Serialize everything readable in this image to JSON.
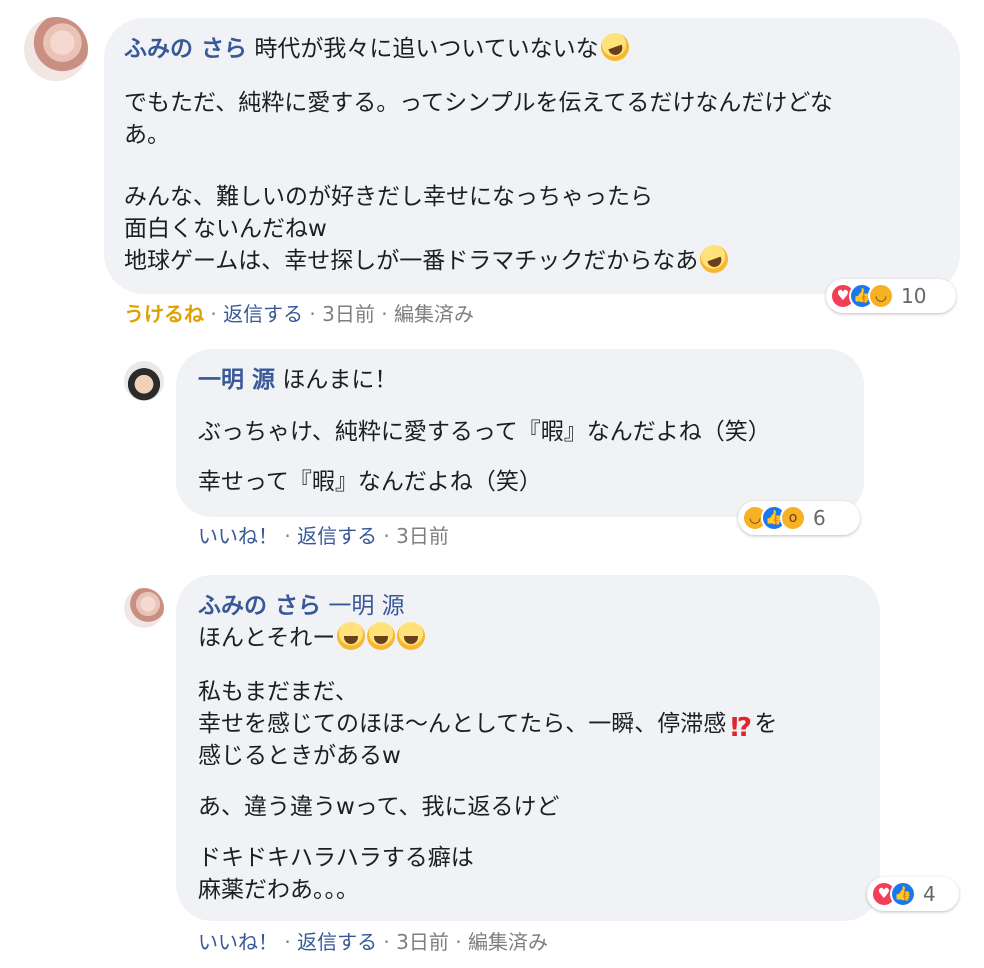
{
  "comments": [
    {
      "author": "ふみの さら",
      "line0": "時代が我々に追いついていないな",
      "body": [
        "でもただ、純粋に愛する。ってシンプルを伝えてるだけなんだけどな",
        "あ。",
        "みんな、難しいのが好きだし幸せになっちゃったら",
        "面白くないんだねw",
        "地球ゲームは、幸せ探しが一番ドラマチックだからなあ"
      ],
      "actions": {
        "like": "うけるね",
        "reply": "返信する",
        "time": "3日前",
        "edited": "編集済み"
      },
      "reactions": {
        "icons": [
          "love",
          "like",
          "haha"
        ],
        "count": "10"
      }
    },
    {
      "author": "一明 源",
      "line0": "ほんまに！",
      "body": [
        "ぶっちゃけ、純粋に愛するって『暇』なんだよね（笑）",
        "幸せって『暇』なんだよね（笑）"
      ],
      "actions": {
        "like": "いいね！",
        "reply": "返信する",
        "time": "3日前"
      },
      "reactions": {
        "icons": [
          "haha",
          "like",
          "wow"
        ],
        "count": "6"
      }
    },
    {
      "author": "ふみの さら",
      "mention": "一明 源",
      "line0": "ほんとそれー",
      "body": [
        "私もまだまだ、",
        "幸せを感じてのほほ〜んとしてたら、一瞬、停滞感",
        "を",
        "感じるときがあるw",
        "あ、違う違うwって、我に返るけど",
        "ドキドキハラハラする癖は",
        "麻薬だわあ。。。"
      ],
      "actions": {
        "like": "いいね！",
        "reply": "返信する",
        "time": "3日前",
        "edited": "編集済み"
      },
      "reactions": {
        "icons": [
          "love",
          "like"
        ],
        "count": "4"
      }
    }
  ],
  "separator": " · ",
  "colors": {
    "name": "#385898",
    "bubble": "#f0f2f5",
    "meta": "#65676b",
    "like_orange": "#e0a000"
  },
  "emoji": {
    "rofl": "rolling-on-floor-laughing",
    "joy": "face-with-tears-of-joy",
    "interrobang": "exclamation-question-mark"
  }
}
